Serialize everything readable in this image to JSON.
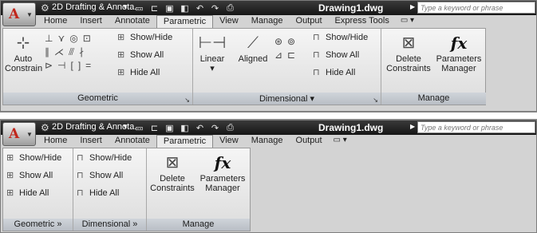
{
  "windows": [
    {
      "app_logo": "A",
      "workspace": "2D Drafting & Annota...",
      "doc_title": "Drawing1.dwg",
      "search_placeholder": "Type a keyword or phrase",
      "tabs": [
        "Home",
        "Insert",
        "Annotate",
        "Parametric",
        "View",
        "Manage",
        "Output",
        "Express Tools"
      ],
      "active_tab": "Parametric",
      "panels": {
        "geometric": {
          "label": "Geometric",
          "auto_label_1": "Auto",
          "auto_label_2": "Constrain"
        },
        "constraint_bar": {
          "show_hide": "Show/Hide",
          "show_all": "Show All",
          "hide_all": "Hide All"
        },
        "dimensional": {
          "label": "Dimensional",
          "linear": "Linear",
          "aligned": "Aligned",
          "show_hide": "Show/Hide",
          "show_all": "Show All",
          "hide_all": "Hide All"
        },
        "manage": {
          "label": "Manage",
          "delete_1": "Delete",
          "delete_2": "Constraints",
          "params_1": "Parameters",
          "params_2": "Manager",
          "fx": "fx"
        }
      }
    },
    {
      "app_logo": "A",
      "workspace": "2D Drafting & Annota...",
      "doc_title": "Drawing1.dwg",
      "search_placeholder": "Type a keyword or phrase",
      "tabs": [
        "Home",
        "Insert",
        "Annotate",
        "Parametric",
        "View",
        "Manage",
        "Output"
      ],
      "active_tab": "Parametric",
      "panels": {
        "geometric": {
          "label": "Geometric",
          "show_hide": "Show/Hide",
          "show_all": "Show All",
          "hide_all": "Hide All"
        },
        "dimensional": {
          "label": "Dimensional",
          "show_hide": "Show/Hide",
          "show_all": "Show All",
          "hide_all": "Hide All"
        },
        "manage": {
          "label": "Manage",
          "delete_1": "Delete",
          "delete_2": "Constraints",
          "params_1": "Parameters",
          "params_2": "Manager",
          "fx": "fx"
        }
      }
    }
  ]
}
